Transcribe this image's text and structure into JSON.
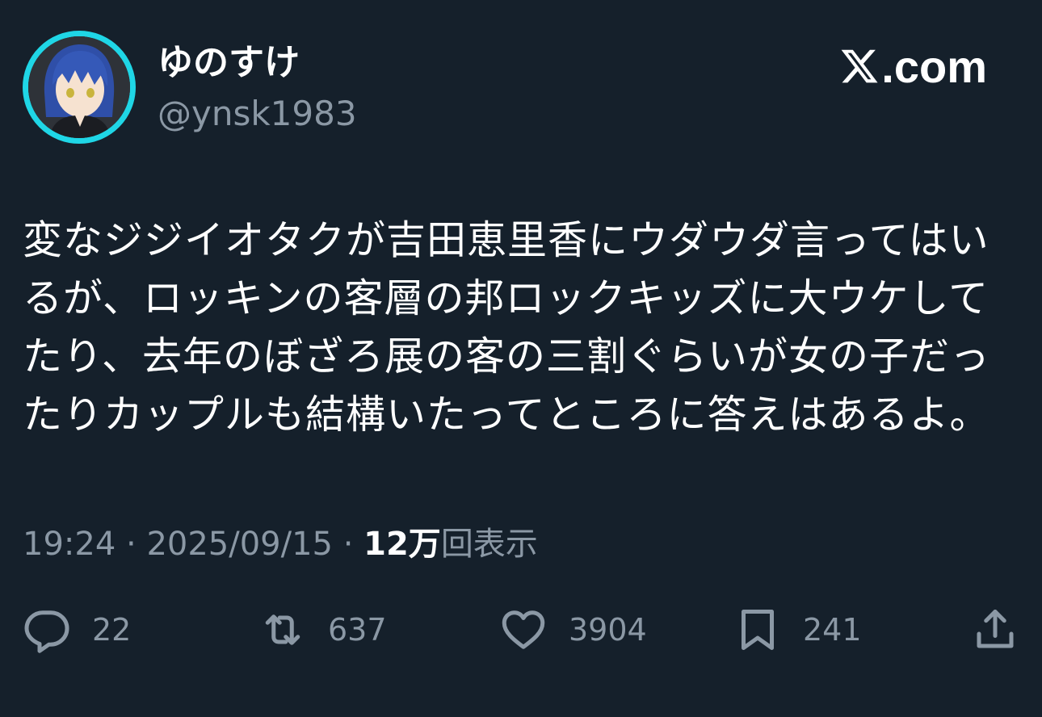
{
  "user": {
    "display_name": "ゆのすけ",
    "handle": "@ynsk1983"
  },
  "brand": {
    "logo": "x-logo-icon",
    "domain_suffix": ".com"
  },
  "tweet": {
    "lines": [
      "変なジジイオタクが吉田恵里香にウダウダ言ってはい",
      "るが、ロッキンの客層の邦ロックキッズに大ウケして",
      "たり、去年のぼざろ展の客の三割ぐらいが女の子だっ",
      "たりカップルも結構いたってところに答えはあるよ。"
    ]
  },
  "meta": {
    "time": "19:24",
    "sep1": " · ",
    "date": "2025/09/15",
    "sep2": " · ",
    "views_count": "12万",
    "views_label": "回表示"
  },
  "actions": {
    "reply": {
      "icon": "reply-icon",
      "count": "22"
    },
    "retweet": {
      "icon": "retweet-icon",
      "count": "637"
    },
    "like": {
      "icon": "heart-icon",
      "count": "3904"
    },
    "bookmark": {
      "icon": "bookmark-icon",
      "count": "241"
    },
    "share": {
      "icon": "share-icon"
    }
  },
  "colors": {
    "background": "#15202b",
    "text_primary": "#ffffff",
    "text_secondary": "#8b98a5",
    "avatar_ring": "#1fd6e6"
  }
}
